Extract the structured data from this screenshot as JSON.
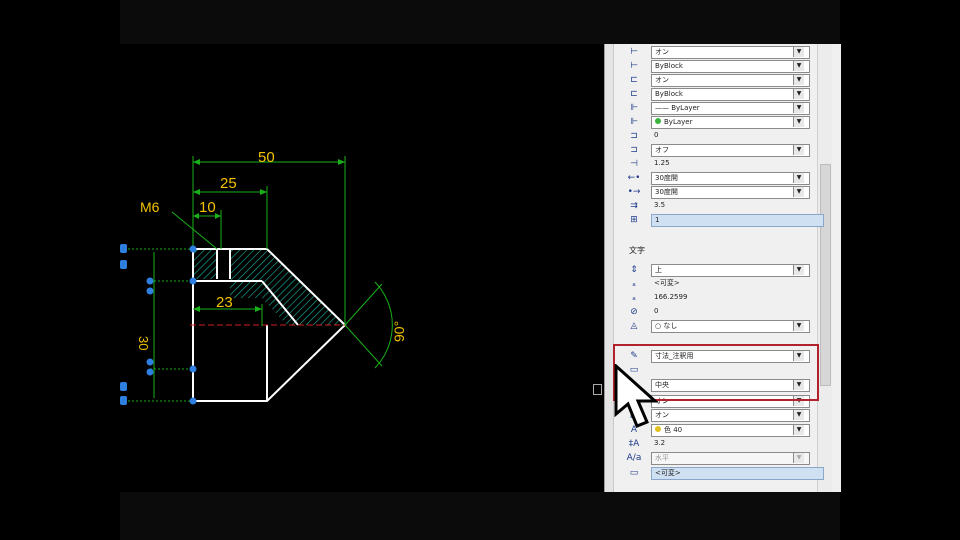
{
  "drawing": {
    "dimensions": {
      "d50": "50",
      "d25": "25",
      "d10": "10",
      "d23": "23",
      "d30": "30",
      "angle": "90°",
      "thread": "M6"
    }
  },
  "properties_panel": {
    "rows_top": [
      {
        "icon": "dim-line-icon",
        "value": "オン",
        "dropdown": true
      },
      {
        "icon": "dim-line-color-icon",
        "value": "ByBlock",
        "dropdown": true
      },
      {
        "icon": "ext-line-icon",
        "value": "オン",
        "dropdown": true
      },
      {
        "icon": "ext-line-color-icon",
        "value": "ByBlock",
        "dropdown": true
      },
      {
        "icon": "linetype-icon",
        "value": "—— ByLayer",
        "dropdown": true
      },
      {
        "icon": "color-icon",
        "value": "ByLayer",
        "dropdown": true,
        "swatch": "#3bb33b"
      },
      {
        "icon": "offset-icon",
        "value": "0",
        "dropdown": false
      },
      {
        "icon": "fixed-ext-icon",
        "value": "オフ",
        "dropdown": true
      },
      {
        "icon": "ext-length-icon",
        "value": "1.25",
        "dropdown": false
      },
      {
        "icon": "arrow1-icon",
        "value": "30度開",
        "dropdown": true
      },
      {
        "icon": "arrow2-icon",
        "value": "30度開",
        "dropdown": true
      },
      {
        "icon": "arrow-size-icon",
        "value": "3.5",
        "dropdown": false
      },
      {
        "icon": "gap-icon",
        "value": "1",
        "dropdown": false,
        "selected": true
      }
    ],
    "section_title": "文字",
    "rows_text": [
      {
        "icon": "vertical-pos-icon",
        "value": "上",
        "dropdown": true
      },
      {
        "icon": "text-override-icon",
        "value": "<可変>",
        "dropdown": false
      },
      {
        "icon": "measurement-icon",
        "value": "166.2599",
        "dropdown": false
      },
      {
        "icon": "text-rotation-icon",
        "value": "0",
        "dropdown": false
      },
      {
        "icon": "text-fill-icon",
        "value": "○ なし",
        "dropdown": true
      },
      {
        "icon": "text-style-icon",
        "value": "寸法_注釈用",
        "dropdown": true
      },
      {
        "icon": "text-view-icon",
        "value": "",
        "dropdown": false
      },
      {
        "icon": "horizontal-pos-icon",
        "value": "中央",
        "dropdown": true
      },
      {
        "icon": "text-inside-icon",
        "value": "オン",
        "dropdown": true
      },
      {
        "icon": "text-outside-icon",
        "value": "オン",
        "dropdown": true
      },
      {
        "icon": "text-color-icon",
        "value": "色 40",
        "dropdown": true,
        "swatch": "#e0c020"
      },
      {
        "icon": "text-height-icon",
        "value": "3.2",
        "dropdown": false
      },
      {
        "icon": "text-offset-icon",
        "value": "水平",
        "dropdown": true,
        "disabled": true
      },
      {
        "icon": "text-result-icon",
        "value": "<可変>",
        "dropdown": false,
        "selected": true
      }
    ]
  }
}
